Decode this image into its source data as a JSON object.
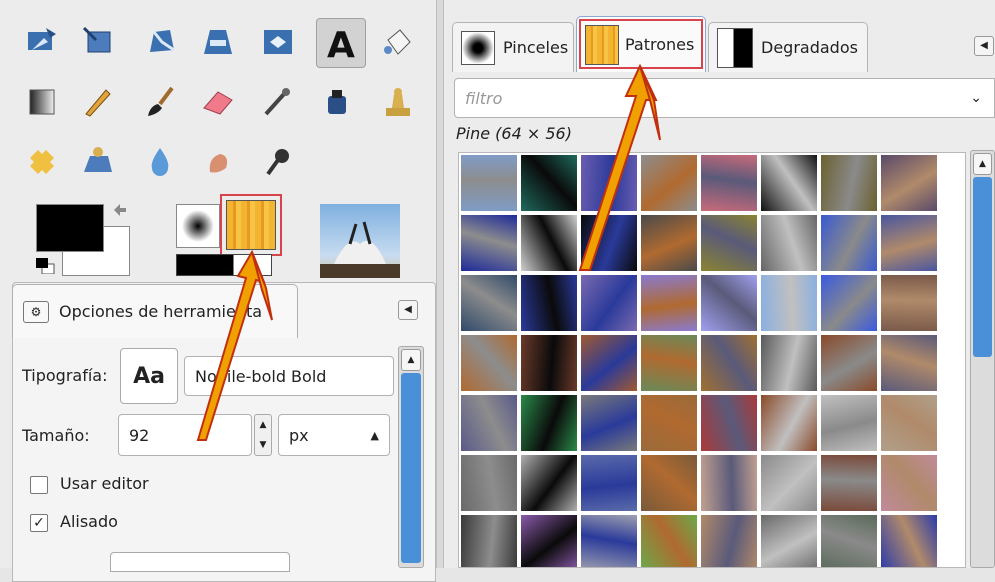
{
  "tool_options": {
    "tab_label": "Opciones de herramienta",
    "font_label": "Tipografía:",
    "font_preview": "Aa",
    "font_value": "Nobile-bold Bold",
    "size_label": "Tamaño:",
    "size_value": "92",
    "unit_value": "px",
    "use_editor_label": "Usar editor",
    "antialias_label": "Alisado"
  },
  "dock": {
    "tabs": [
      {
        "label": "Pinceles"
      },
      {
        "label": "Patrones"
      },
      {
        "label": "Degradados"
      }
    ],
    "filter_placeholder": "filtro",
    "selected_pattern": "Pine (64 × 56)"
  },
  "patterns": [
    "#7f9cc6",
    "#1f6a5e",
    "#6a5cb0",
    "#8d8d8d",
    "#c86a7a",
    "#111111",
    "#6b6130",
    "#5a4a6a",
    "#1e2a9a",
    "#d0d0d0",
    "#0a0a0a",
    "#4a4a4a",
    "#8a8430",
    "#666666",
    "#3a5ad0",
    "#4a56a0",
    "#304a6a",
    "#2a3a9a",
    "#7a6ab0",
    "#8a7ad0",
    "#a0a0f0",
    "#8ab0e0",
    "#3a5ae0",
    "#7a5a4a",
    "#b06a30",
    "#6a3a2a",
    "#a05a30",
    "#6a8a5a",
    "#a07030",
    "#5a5a5a",
    "#8a4a2a",
    "#5a5a7a",
    "#5a5a8a",
    "#2a8a4a",
    "#7a7a7a",
    "#9a6a3a",
    "#aa3a3a",
    "#8a4a2a",
    "#c0c0c0",
    "#b0a08a",
    "#6a6a6a",
    "#b0b0b0",
    "#5a6aaa",
    "#7a5a3a",
    "#c0a090",
    "#8a8a8a",
    "#7a4a3a",
    "#c08a9a",
    "#3a3a3a",
    "#8a5aaa",
    "#a0a0b0",
    "#6aaa4a",
    "#b08a6a",
    "#6a6a6a",
    "#5a6a5a",
    "#2a3aaa"
  ],
  "colors": {
    "accent_red": "#d9434b",
    "arrow_fill": "#f0a000"
  }
}
